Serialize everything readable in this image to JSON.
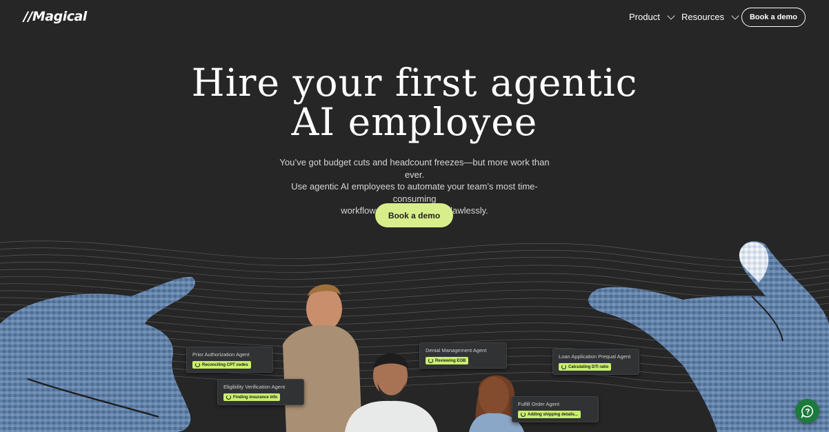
{
  "header": {
    "logo": "//Magical",
    "nav": [
      {
        "label": "Product"
      },
      {
        "label": "Resources"
      }
    ],
    "cta_label": "Book a demo"
  },
  "hero": {
    "title_line1": "Hire your first agentic",
    "title_line2": "AI employee",
    "subtitle_line1": "You’ve got budget cuts and headcount freezes—but more work than ever.",
    "subtitle_line2": "Use agentic AI  employees to automate your team’s most time-consuming",
    "subtitle_line3": "workflows faster and more flawlessly.",
    "cta_label": "Book a demo"
  },
  "agents": [
    {
      "name": "Prior Authorization Agent",
      "status": "Reconciling CPT codes"
    },
    {
      "name": "Eligibility Verification Agent",
      "status": "Finding insurance info"
    },
    {
      "name": "Denial Management Agent",
      "status": "Reviewing EOB"
    },
    {
      "name": "Loan Application Prequal Agent",
      "status": "Calculating DTI ratio"
    },
    {
      "name": "Fulfill Order Agent",
      "status": "Adding shipping details..."
    }
  ],
  "icons": {
    "nav_chevron": "chevron-down-icon",
    "status": "sync-icon",
    "chat": "help-chat-icon"
  },
  "colors": {
    "background": "#262626",
    "accent": "#d8ee8a",
    "status_badge": "#c9ef6e",
    "chat_button": "#1c7a3c",
    "hand": "#5f7fa6"
  }
}
